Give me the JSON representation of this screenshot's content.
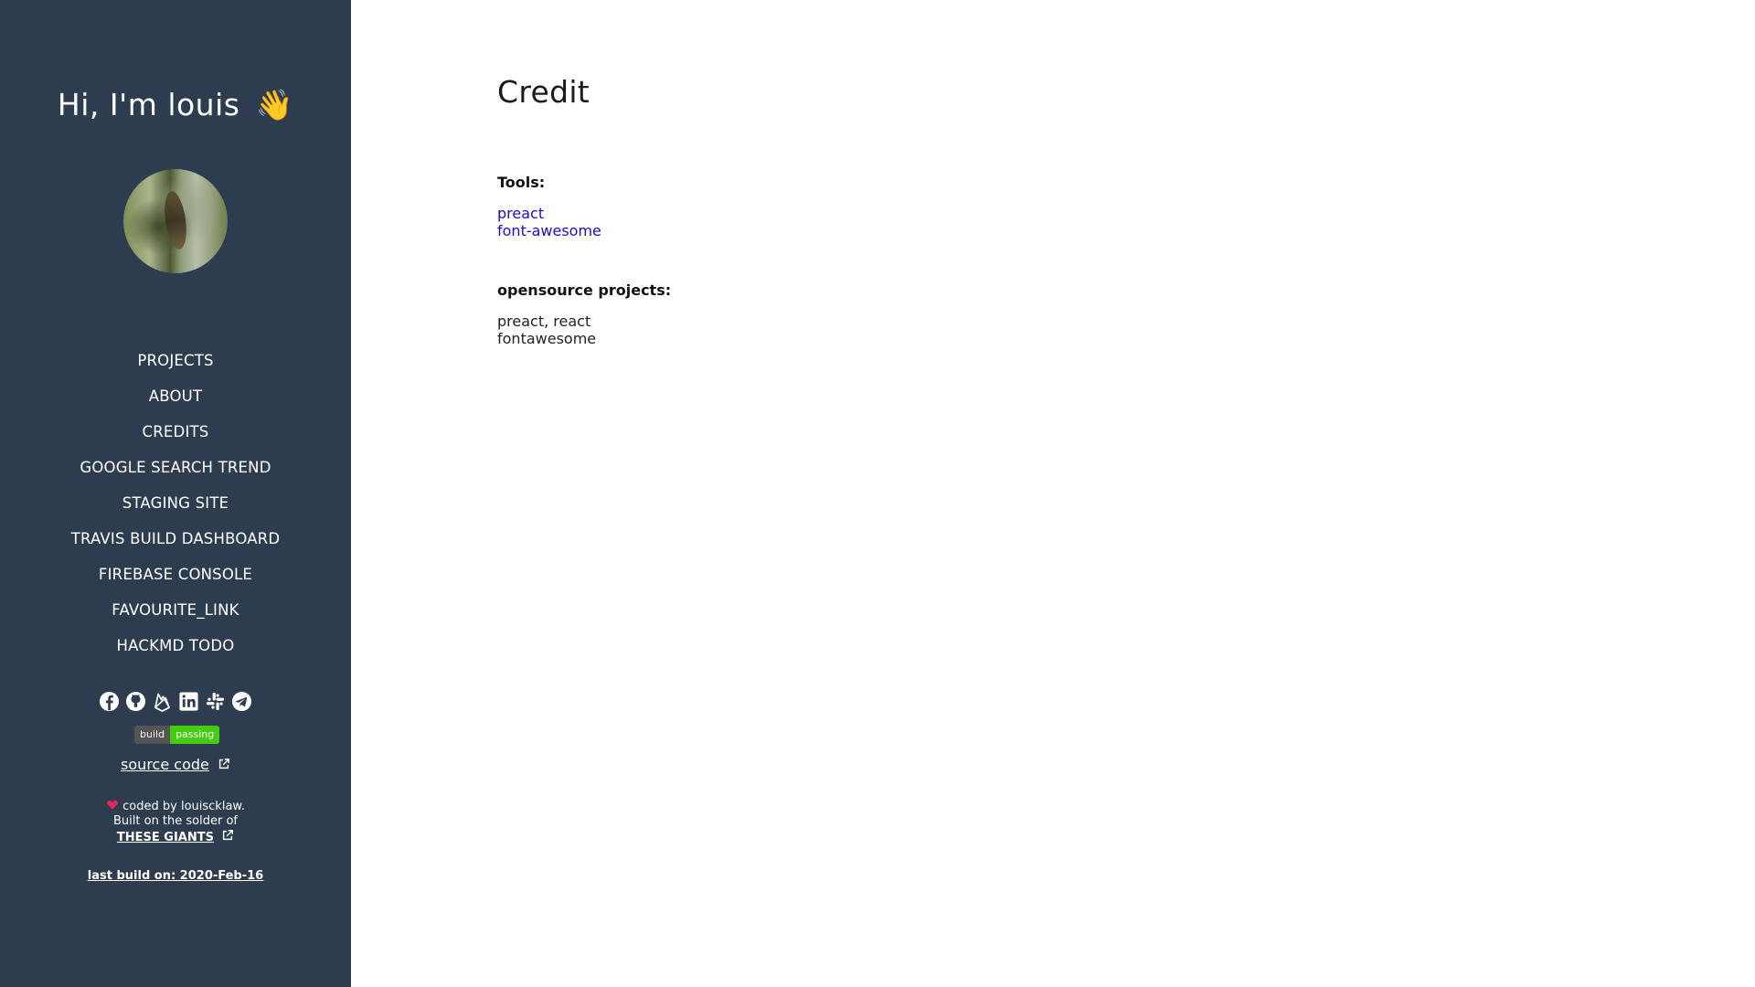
{
  "sidebar": {
    "greeting": "Hi, I'm louis",
    "wave_emoji": "👋",
    "nav_items": [
      {
        "label": "PROJECTS"
      },
      {
        "label": "ABOUT"
      },
      {
        "label": "CREDITS"
      },
      {
        "label": "GOOGLE SEARCH TREND"
      },
      {
        "label": "STAGING SITE"
      },
      {
        "label": "TRAVIS BUILD DASHBOARD"
      },
      {
        "label": "FIREBASE CONSOLE"
      },
      {
        "label": "FAVOURITE_LINK"
      },
      {
        "label": "HACKMD TODO"
      }
    ],
    "social_icons": [
      "facebook-icon",
      "github-icon",
      "firebase-icon",
      "linkedin-icon",
      "slack-icon",
      "telegram-icon"
    ],
    "badge": {
      "left": "build",
      "right": "passing"
    },
    "source_code": "source code",
    "coded_by": "coded by louiscklaw.",
    "built_on": "Built on the solder of",
    "giants": "THESE GIANTS",
    "last_build": "last build on: 2020-Feb-16",
    "colors": {
      "background": "#2d3c4e",
      "heart": "#e0245e",
      "badge_pass": "#44cc11"
    }
  },
  "main": {
    "title": "Credit",
    "tools_heading": "Tools:",
    "tools": [
      "preact",
      "font-awesome"
    ],
    "projects_heading": "opensource projects:",
    "projects": [
      "preact, react",
      "fontawesome"
    ],
    "colors": {
      "link": "#1a0dcc"
    }
  }
}
